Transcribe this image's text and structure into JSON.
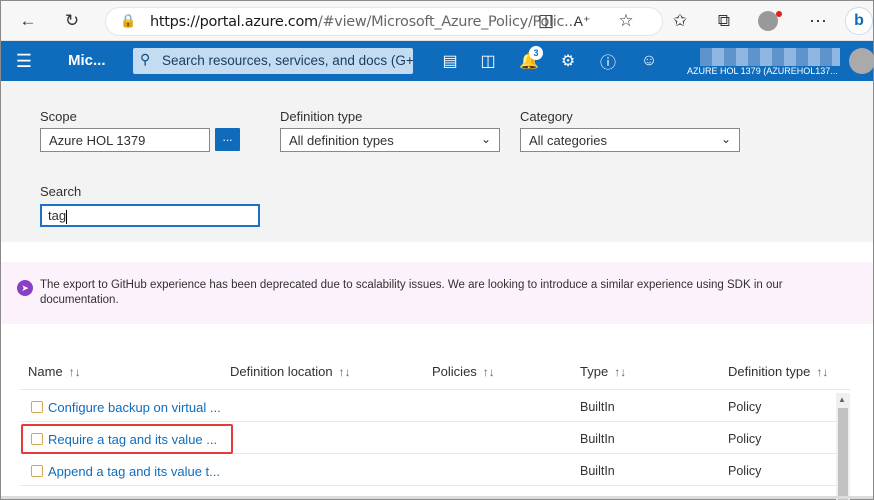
{
  "browser": {
    "url_host": "https://portal.azure.com",
    "url_path": "/#view/Microsoft_Azure_Policy/Polic..."
  },
  "header": {
    "title": "Mic...",
    "search_placeholder": "Search resources, services, and docs (G+/)",
    "notification_count": "3",
    "account_name": "AZURE HOL 1379 (AZUREHOL137..."
  },
  "filters": {
    "scope_label": "Scope",
    "scope_value": "Azure HOL 1379",
    "scope_button": "...",
    "definition_type_label": "Definition type",
    "definition_type_value": "All definition types",
    "category_label": "Category",
    "category_value": "All categories",
    "search_label": "Search",
    "search_value": "tag"
  },
  "banner": {
    "text": "The export to GitHub experience has been deprecated due to scalability issues. We are looking to introduce a similar experience using SDK in our documentation."
  },
  "table": {
    "columns": [
      "Name",
      "Definition location",
      "Policies",
      "Type",
      "Definition type"
    ],
    "sort_icon": "↑↓",
    "rows": [
      {
        "name": "Configure backup on virtual ...",
        "location": "",
        "policies": "",
        "type": "BuiltIn",
        "definition_type": "Policy"
      },
      {
        "name": "Require a tag and its value ...",
        "location": "",
        "policies": "",
        "type": "BuiltIn",
        "definition_type": "Policy"
      },
      {
        "name": "Append a tag and its value t...",
        "location": "",
        "policies": "",
        "type": "BuiltIn",
        "definition_type": "Policy"
      }
    ]
  },
  "colors": {
    "azure_blue": "#0f6cbd",
    "highlight_red": "#e33b3b",
    "banner_bg": "#fcf2fc"
  }
}
